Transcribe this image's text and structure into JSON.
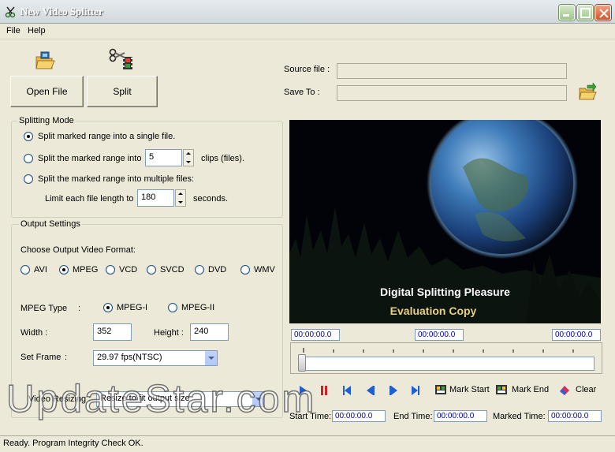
{
  "window": {
    "title": "New Video Splitter"
  },
  "menu": {
    "items": [
      "File",
      "Help"
    ]
  },
  "toolbar": {
    "open_label": "Open File",
    "split_label": "Split"
  },
  "source": {
    "source_label": "Source file :",
    "save_label": "Save To :",
    "source_value": "",
    "save_value": ""
  },
  "splitting_mode": {
    "title": "Splitting Mode",
    "option1": "Split marked range into a single file.",
    "option2_pre": "Split the marked range into",
    "option2_value": "5",
    "option2_post": "clips (files).",
    "option3": "Split the marked range into multiple files:",
    "limit_label": "Limit each file length to",
    "limit_value": "180",
    "limit_unit": "seconds.",
    "selected": 1
  },
  "output": {
    "title": "Output Settings",
    "format_label": "Choose Output Video Format:",
    "formats": [
      "AVI",
      "MPEG",
      "VCD",
      "SVCD",
      "DVD",
      "WMV"
    ],
    "selected_format": "MPEG",
    "mpeg_type_label": "MPEG Type",
    "mpeg_colon": ":",
    "mpeg_types": [
      "MPEG-I",
      "MPEG-II"
    ],
    "selected_mpeg": "MPEG-I",
    "width_label": "Width :",
    "width_value": "352",
    "height_label": "Height :",
    "height_value": "240",
    "frame_label": "Set Frame",
    "frame_colon": ":",
    "frame_value": "29.97 fps(NTSC)",
    "resize_label": "Video Resizing :",
    "resize_value": "Resize to fit output size"
  },
  "video": {
    "caption1": "Digital Splitting Pleasure",
    "caption2": "Evaluation Copy"
  },
  "timeline": {
    "time_left": "00:00:00.0",
    "time_mid": "00:00:00.0",
    "time_right": "00:00:00.0"
  },
  "controls": {
    "mark_start": "Mark Start",
    "mark_end": "Mark End",
    "clear": "Clear",
    "start_time_label": "Start Time:",
    "start_time": "00:00:00.0",
    "end_time_label": "End Time:",
    "end_time": "00:00:00.0",
    "marked_time_label": "Marked Time:",
    "marked_time": "00:00:00.0"
  },
  "status": {
    "text": "Ready. Program Integrity Check OK."
  },
  "watermark": {
    "text": "UpdateStar.com"
  },
  "colors": {
    "accent_blue": "#1F5FD0",
    "stop_red": "#D02020",
    "caption_gold": "#E8D080"
  }
}
